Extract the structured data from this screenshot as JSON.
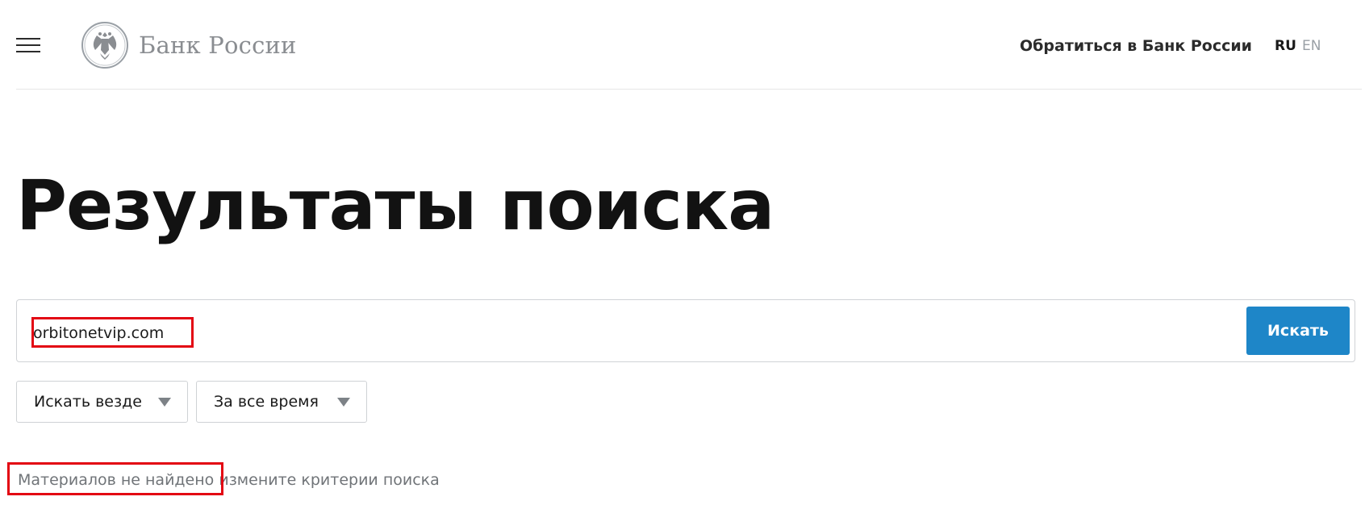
{
  "header": {
    "logo_text": "Банк России",
    "contact_link": "Обратиться в Банк России",
    "languages": [
      "RU",
      "EN"
    ],
    "active_language": "RU"
  },
  "page": {
    "title": "Результаты поиска"
  },
  "search": {
    "query": "orbitonetvip.com",
    "button_label": "Искать"
  },
  "filters": {
    "scope_label": "Искать везде",
    "period_label": "За все время"
  },
  "results": {
    "not_found": "Материалов не найдено",
    "hint": "измените критерии поиска"
  },
  "colors": {
    "accent": "#1e86c8",
    "highlight": "#e30613",
    "muted_text": "#707478"
  },
  "icons": {
    "menu": "hamburger-menu-icon",
    "logo": "double-headed-eagle-emblem",
    "dropdown": "caret-down-icon"
  }
}
